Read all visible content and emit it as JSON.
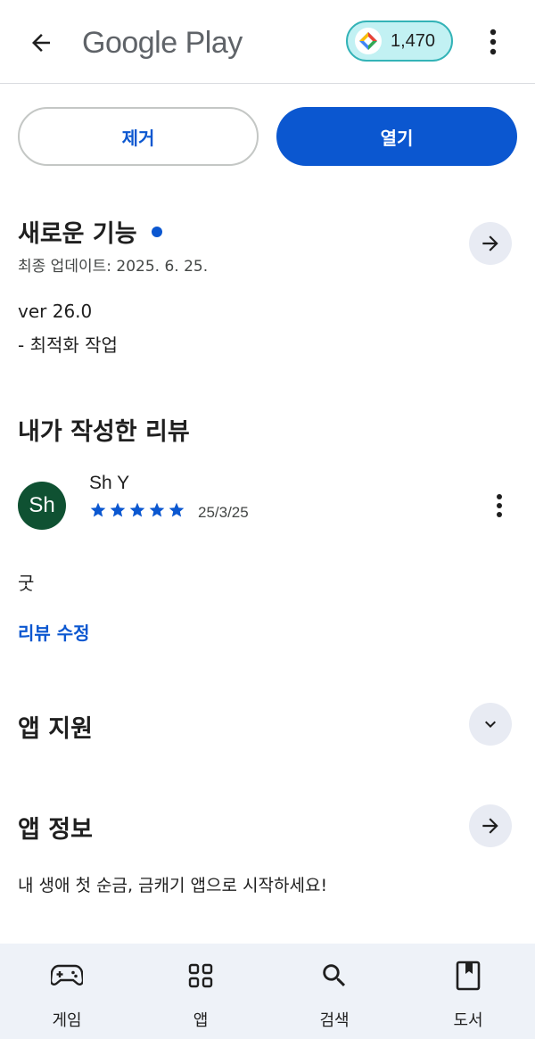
{
  "header": {
    "title": "Google Play",
    "points": "1,470",
    "back_icon": "arrow-back-icon",
    "more_icon": "more-vert-icon"
  },
  "actions": {
    "remove_label": "제거",
    "open_label": "열기"
  },
  "whats_new": {
    "title": "새로운 기능",
    "updated": "최종 업데이트: 2025. 6. 25.",
    "version": "ver 26.0",
    "notes": "- 최적화 작업"
  },
  "my_review": {
    "title": "내가 작성한 리뷰",
    "avatar_text": "Sh",
    "author": "Sh Y",
    "rating": 5,
    "date": "25/3/25",
    "text": "굿",
    "edit_label": "리뷰 수정"
  },
  "app_support": {
    "title": "앱 지원"
  },
  "app_info": {
    "title": "앱 정보",
    "description": "내 생애 첫 순금, 금캐기 앱으로 시작하세요!"
  },
  "bottom_nav": [
    {
      "label": "게임",
      "icon": "gamepad-icon"
    },
    {
      "label": "앱",
      "icon": "apps-grid-icon"
    },
    {
      "label": "검색",
      "icon": "search-icon"
    },
    {
      "label": "도서",
      "icon": "book-icon"
    }
  ],
  "colors": {
    "accent": "#0b57d0",
    "avatar": "#0f5132",
    "points_chip_bg": "#c2f1f3",
    "points_chip_border": "#33b3b7",
    "nav_bg": "#eef2f8"
  }
}
